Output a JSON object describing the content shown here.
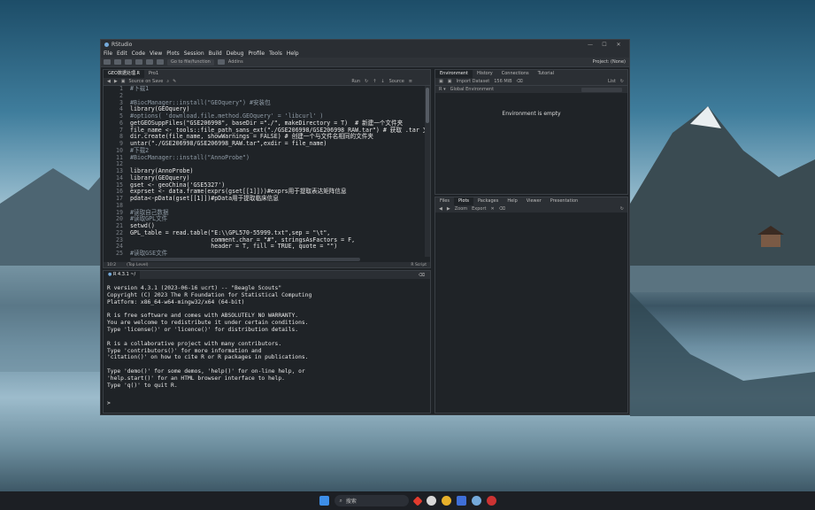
{
  "window": {
    "title": "RStudio",
    "controls": [
      "—",
      "☐",
      "✕"
    ]
  },
  "menu": [
    "File",
    "Edit",
    "Code",
    "View",
    "Plots",
    "Session",
    "Build",
    "Debug",
    "Profile",
    "Tools",
    "Help"
  ],
  "toolbar": {
    "goto_label": "Go to file/function",
    "addins_label": "Addins",
    "project_label": "Project: (None)"
  },
  "editor": {
    "tabs": [
      "GEO数据处理.R",
      "Pro1"
    ],
    "source_on_save": "Source on Save",
    "run_label": "Run",
    "source_label": "Source",
    "lines": [
      {
        "n": "1",
        "t": "#下载1",
        "c": "cm"
      },
      {
        "n": "2",
        "t": "",
        "c": "ct"
      },
      {
        "n": "3",
        "t": "#BiocManager::install(\"GEOquery\") #安装包",
        "c": "cm"
      },
      {
        "n": "4",
        "t": "library(GEOquery)",
        "c": "ct"
      },
      {
        "n": "5",
        "t": "#options( 'download.file.method.GEOquery' = 'libcurl' )",
        "c": "cm"
      },
      {
        "n": "6",
        "t": "getGEOSuppFiles(\"GSE206998\", baseDir =\"./\", makeDirectory = T)  # 新建一个文件夹",
        "c": "ct"
      },
      {
        "n": "7",
        "t": "file_name <- tools::file_path_sans_ext(\"./GSE206998/GSE206998_RAW.tar\") # 获取 .tar 文件",
        "c": "ct"
      },
      {
        "n": "8",
        "t": "dir.create(file_name, showWarnings = FALSE) # 创建一个与文件名相同的文件夹",
        "c": "ct"
      },
      {
        "n": "9",
        "t": "untar(\"./GSE206998/GSE206998_RAW.tar\",exdir = file_name)",
        "c": "ct"
      },
      {
        "n": "10",
        "t": "#下载2",
        "c": "cm"
      },
      {
        "n": "11",
        "t": "#BiocManager::install(\"AnnoProbe\")",
        "c": "cm"
      },
      {
        "n": "12",
        "t": "",
        "c": "ct"
      },
      {
        "n": "13",
        "t": "library(AnnoProbe)",
        "c": "ct"
      },
      {
        "n": "14",
        "t": "library(GEOquery)",
        "c": "ct"
      },
      {
        "n": "15",
        "t": "gset <- geoChina('GSE5327')",
        "c": "ct"
      },
      {
        "n": "16",
        "t": "exprset <- data.frame(exprs(gset[[1]]))#exprs用于提取表达矩阵信息",
        "c": "ct"
      },
      {
        "n": "17",
        "t": "pdata<-pData(gset[[1]])#pData用于提取临床信息",
        "c": "ct"
      },
      {
        "n": "18",
        "t": "",
        "c": "ct"
      },
      {
        "n": "19",
        "t": "#读取自己数据",
        "c": "cm"
      },
      {
        "n": "20",
        "t": "#读取GPL文件",
        "c": "cm"
      },
      {
        "n": "21",
        "t": "setwd()",
        "c": "ct"
      },
      {
        "n": "22",
        "t": "GPL_table = read.table(\"E:\\\\GPL570-55999.txt\",sep = \"\\t\",",
        "c": "ct"
      },
      {
        "n": "23",
        "t": "                       comment.char = \"#\", stringsAsFactors = F,",
        "c": "ct"
      },
      {
        "n": "24",
        "t": "                       header = T, fill = TRUE, quote = \"\")",
        "c": "ct"
      },
      {
        "n": "25",
        "t": "#读取GSE文件",
        "c": "cm"
      }
    ],
    "status_pos": "10:2",
    "status_level": "(Top Level)",
    "status_type": "R Script"
  },
  "console": {
    "tab": "R 4.3.1",
    "path": "~/",
    "text": "R version 4.3.1 (2023-06-16 ucrt) -- \"Beagle Scouts\"\nCopyright (C) 2023 The R Foundation for Statistical Computing\nPlatform: x86_64-w64-mingw32/x64 (64-bit)\n\nR is free software and comes with ABSOLUTELY NO WARRANTY.\nYou are welcome to redistribute it under certain conditions.\nType 'license()' or 'licence()' for distribution details.\n\nR is a collaborative project with many contributors.\nType 'contributors()' for more information and\n'citation()' on how to cite R or R packages in publications.\n\nType 'demo()' for some demos, 'help()' for on-line help, or\n'help.start()' for an HTML browser interface to help.\nType 'q()' to quit R.",
    "prompt": ">"
  },
  "env": {
    "tabs": [
      "Environment",
      "History",
      "Connections",
      "Tutorial"
    ],
    "import_label": "Import Dataset",
    "memory_label": "156 MiB",
    "list_label": "List",
    "scope_label": "Global Environment",
    "empty_text": "Environment is empty"
  },
  "files": {
    "tabs": [
      "Files",
      "Plots",
      "Packages",
      "Help",
      "Viewer",
      "Presentation"
    ],
    "zoom_label": "Zoom",
    "export_label": "Export"
  },
  "taskbar": {
    "search_label": "搜索"
  }
}
